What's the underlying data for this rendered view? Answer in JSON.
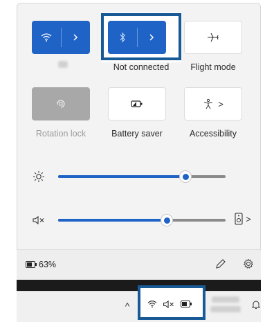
{
  "tiles": {
    "wifi": {
      "icon": "wifi-icon",
      "network_name_blurred": true
    },
    "bluetooth": {
      "icon": "bluetooth-icon",
      "label": "Not connected"
    },
    "flight_mode": {
      "icon": "airplane-icon",
      "label": "Flight mode"
    },
    "rotation_lock": {
      "icon": "rotation-lock-icon",
      "label": "Rotation lock"
    },
    "battery_saver": {
      "icon": "battery-saver-icon",
      "label": "Battery saver"
    },
    "accessibility": {
      "icon": "accessibility-icon",
      "label": "Accessibility",
      "chevron": ">"
    }
  },
  "sliders": {
    "brightness": {
      "icon": "sun-icon",
      "level": 0.76
    },
    "volume": {
      "icon": "speaker-muted-icon",
      "level": 0.65,
      "output_icon": "speaker-device-icon",
      "chevron": ">"
    }
  },
  "footer": {
    "battery_percent": "63%",
    "edit_icon": "pencil-icon",
    "settings_icon": "gear-icon"
  },
  "taskbar": {
    "overflow_chevron": "^",
    "mute_glyph": "×",
    "tray_icons": [
      "wifi-icon",
      "speaker-muted-icon",
      "battery-icon"
    ],
    "notification_icon": "notification-icon"
  },
  "colors": {
    "accent": "#1f63c6",
    "highlight_box": "#175a96",
    "panel_bg": "#f3f3f3"
  }
}
